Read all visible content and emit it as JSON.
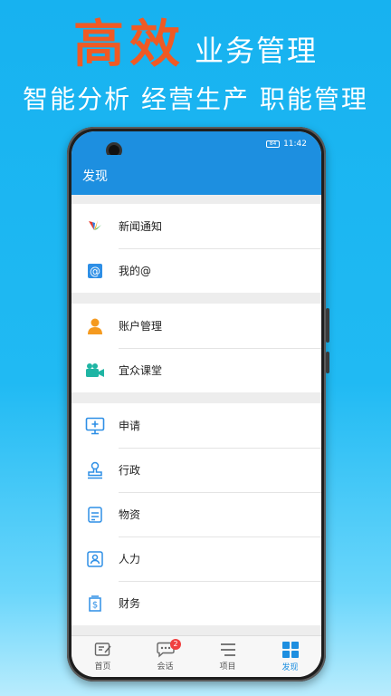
{
  "promo": {
    "headline": "高效",
    "headline_suffix": "业务管理",
    "tagline": "智能分析 经营生产 职能管理"
  },
  "status_bar": {
    "battery": "84",
    "time": "11:42"
  },
  "app_bar": {
    "title": "发现"
  },
  "groups": [
    {
      "items": [
        {
          "label": "新闻通知",
          "icon": "news-icon"
        },
        {
          "label": "我的@",
          "icon": "at-icon"
        }
      ]
    },
    {
      "items": [
        {
          "label": "账户管理",
          "icon": "user-icon"
        },
        {
          "label": "宜众课堂",
          "icon": "video-camera-icon"
        }
      ]
    },
    {
      "items": [
        {
          "label": "申请",
          "icon": "monitor-plus-icon"
        },
        {
          "label": "行政",
          "icon": "stamp-icon"
        },
        {
          "label": "物资",
          "icon": "box-icon"
        },
        {
          "label": "人力",
          "icon": "person-badge-icon"
        },
        {
          "label": "财务",
          "icon": "finance-icon"
        }
      ]
    }
  ],
  "tabs": [
    {
      "label": "首页",
      "icon": "edit-icon"
    },
    {
      "label": "会话",
      "icon": "chat-icon",
      "badge": "2"
    },
    {
      "label": "项目",
      "icon": "list-icon"
    },
    {
      "label": "发现",
      "icon": "grid-icon"
    }
  ],
  "colors": {
    "accent": "#1d8fe0",
    "promo_orange": "#f05a24",
    "badge": "#f04040"
  }
}
